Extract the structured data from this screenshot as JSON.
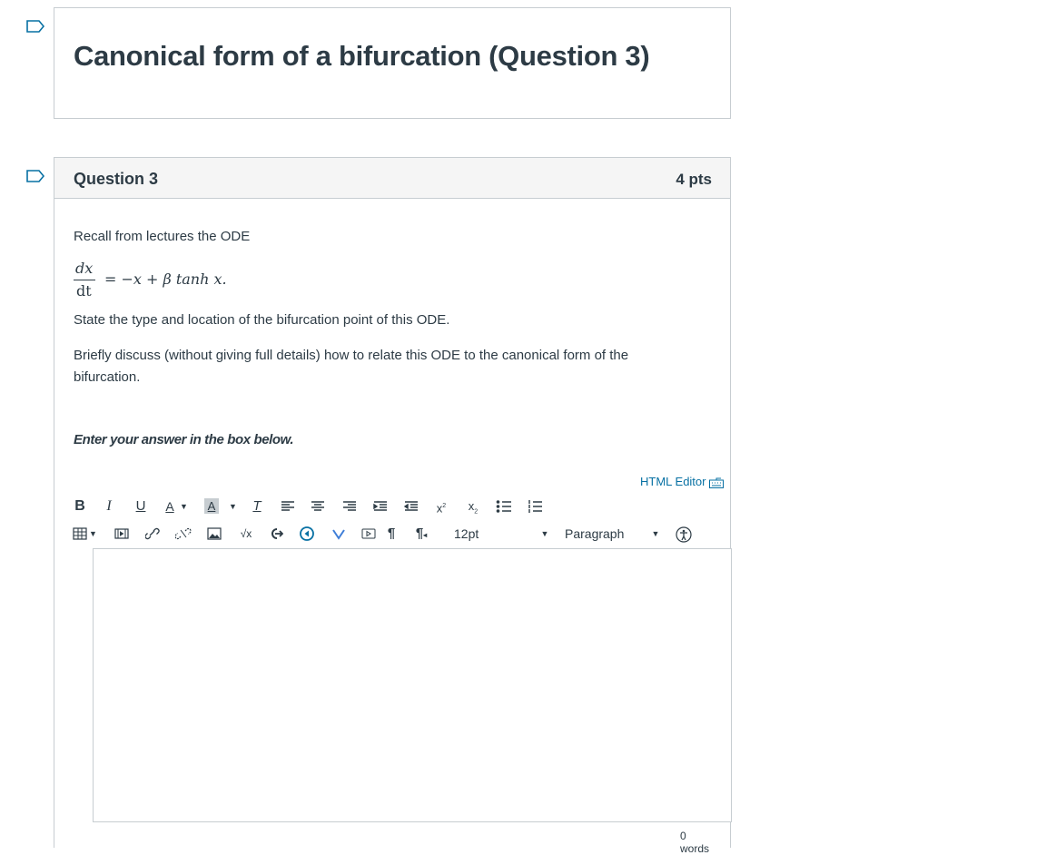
{
  "page_title": "Canonical form of a bifurcation (Question 3)",
  "question": {
    "name": "Question 3",
    "points": "4 pts",
    "intro": "Recall from lectures the ODE",
    "equation": {
      "numerator": "dx",
      "denominator": "dt",
      "rhs": "= −x + β tanh x."
    },
    "prompt_1": "State the type and location of the bifurcation point of this ODE.",
    "prompt_2": "Briefly discuss (without giving full details) how to relate this ODE to the canonical form of the bifurcation.",
    "instruction": "Enter your answer in the box below."
  },
  "editor": {
    "html_editor_link": "HTML Editor",
    "font_size": "12pt",
    "block_format": "Paragraph",
    "word_count": "0 words",
    "toolbar_icons": [
      "bold",
      "italic",
      "underline",
      "text-color",
      "background-color",
      "clear-formatting",
      "align-left",
      "align-center",
      "align-right",
      "indent",
      "outdent",
      "superscript",
      "subscript",
      "bullet-list",
      "numbered-list",
      "table",
      "media",
      "link",
      "unlink",
      "image",
      "equation",
      "lti-tool",
      "record-media",
      "vimeo",
      "embed",
      "ltr",
      "rtl",
      "accessibility-checker"
    ]
  },
  "colors": {
    "border": "#c7cdd1",
    "header_bg": "#f5f5f5",
    "link": "#0770a3",
    "text": "#2d3b45"
  }
}
